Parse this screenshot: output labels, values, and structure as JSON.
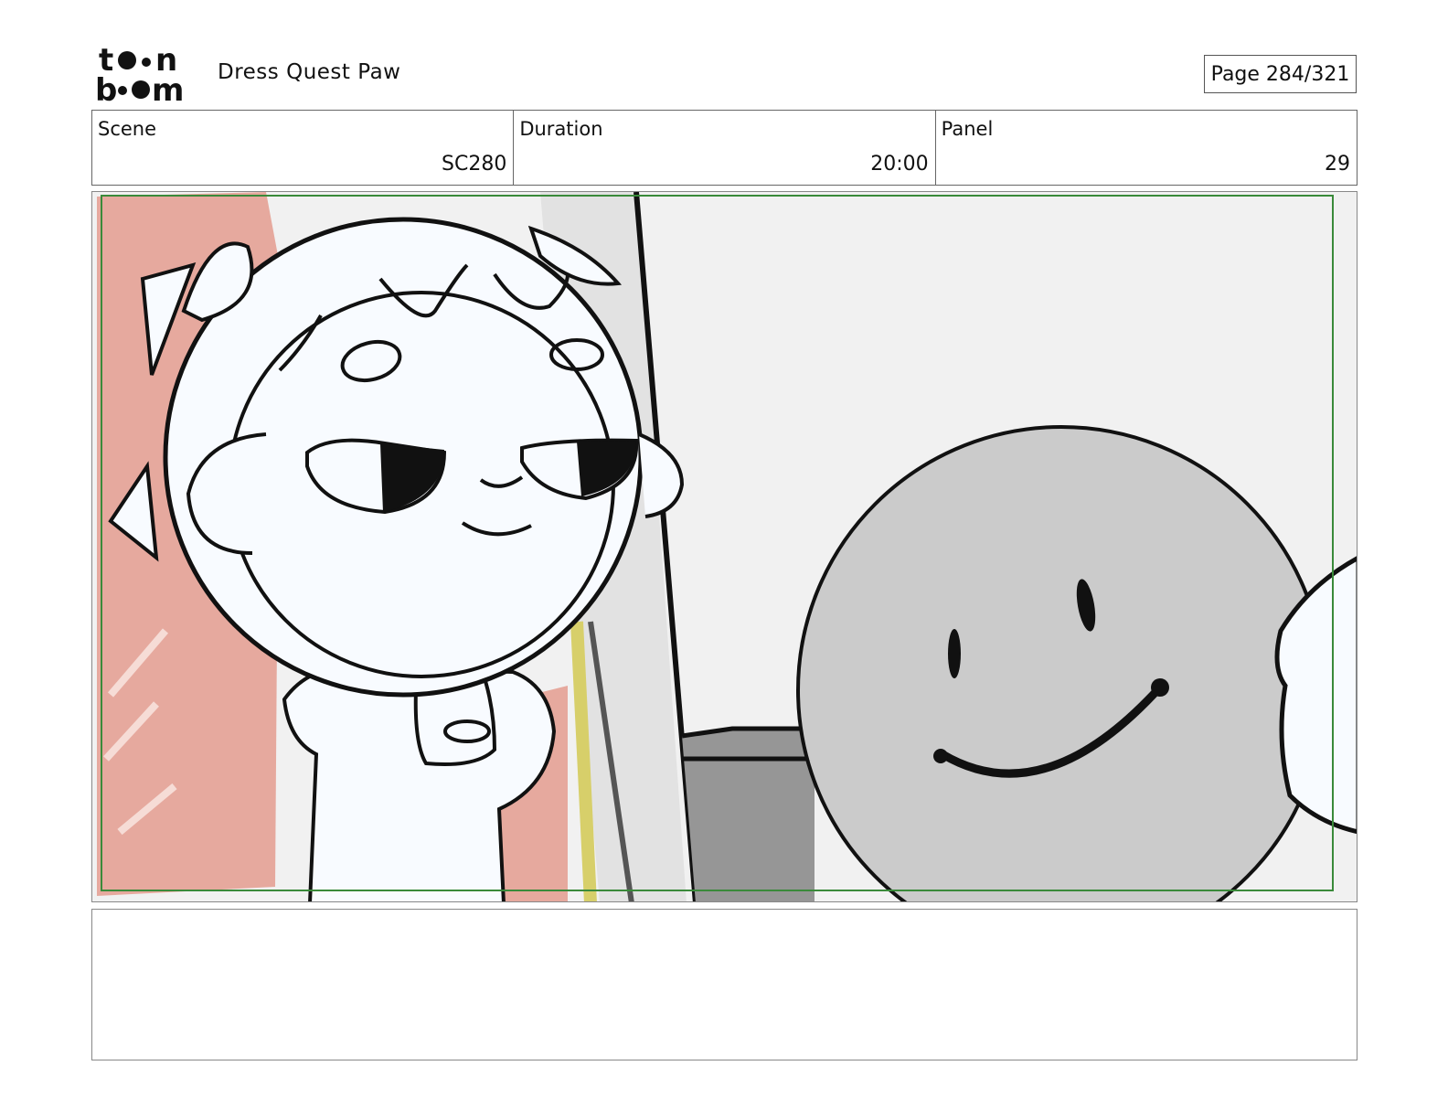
{
  "header": {
    "logo_text_top": "toon",
    "logo_text_bottom": "boom",
    "project_title": "Dress Quest Paw",
    "page_label": "Page 284/321"
  },
  "info": {
    "scene_label": "Scene",
    "scene_value": "SC280",
    "duration_label": "Duration",
    "duration_value": "20:00",
    "panel_label": "Panel",
    "panel_value": "29"
  },
  "notes": {
    "text": ""
  },
  "colors": {
    "safe_frame": "#3a8a3a",
    "background_pink": "#e6a99e",
    "smiley_gray": "#cbcbcb",
    "wall_light": "#f1f1f1"
  }
}
